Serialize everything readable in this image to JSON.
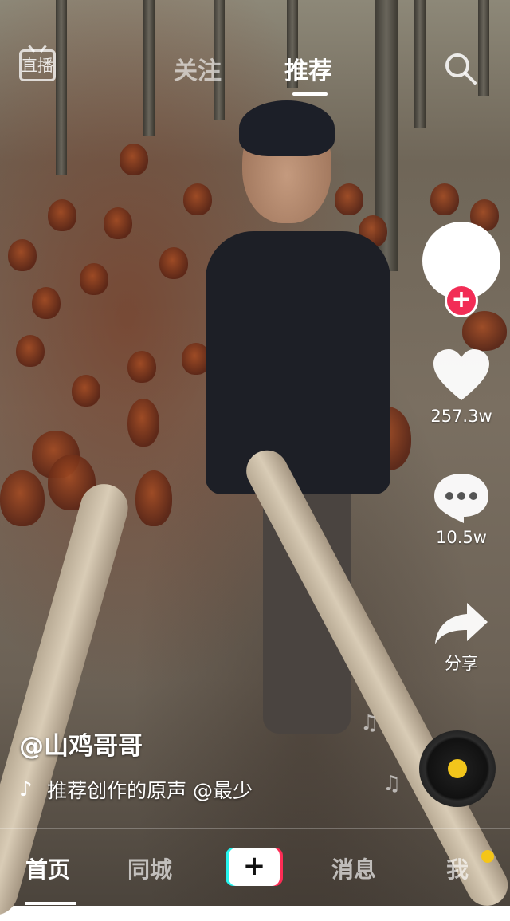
{
  "header": {
    "live_label": "直播",
    "tabs": [
      {
        "label": "关注",
        "active": false
      },
      {
        "label": "推荐",
        "active": true
      }
    ]
  },
  "video": {
    "author": "@山鸡哥哥",
    "music": "推荐创作的原声    @最少"
  },
  "sidebar": {
    "likes": "257.3w",
    "comments": "10.5w",
    "share_label": "分享"
  },
  "nav": {
    "home": "首页",
    "city": "同城",
    "create": "+",
    "messages": "消息",
    "me": "我"
  },
  "colors": {
    "accent_red": "#f22d56",
    "disc_center": "#f2c51b",
    "badge": "#f5c518"
  }
}
